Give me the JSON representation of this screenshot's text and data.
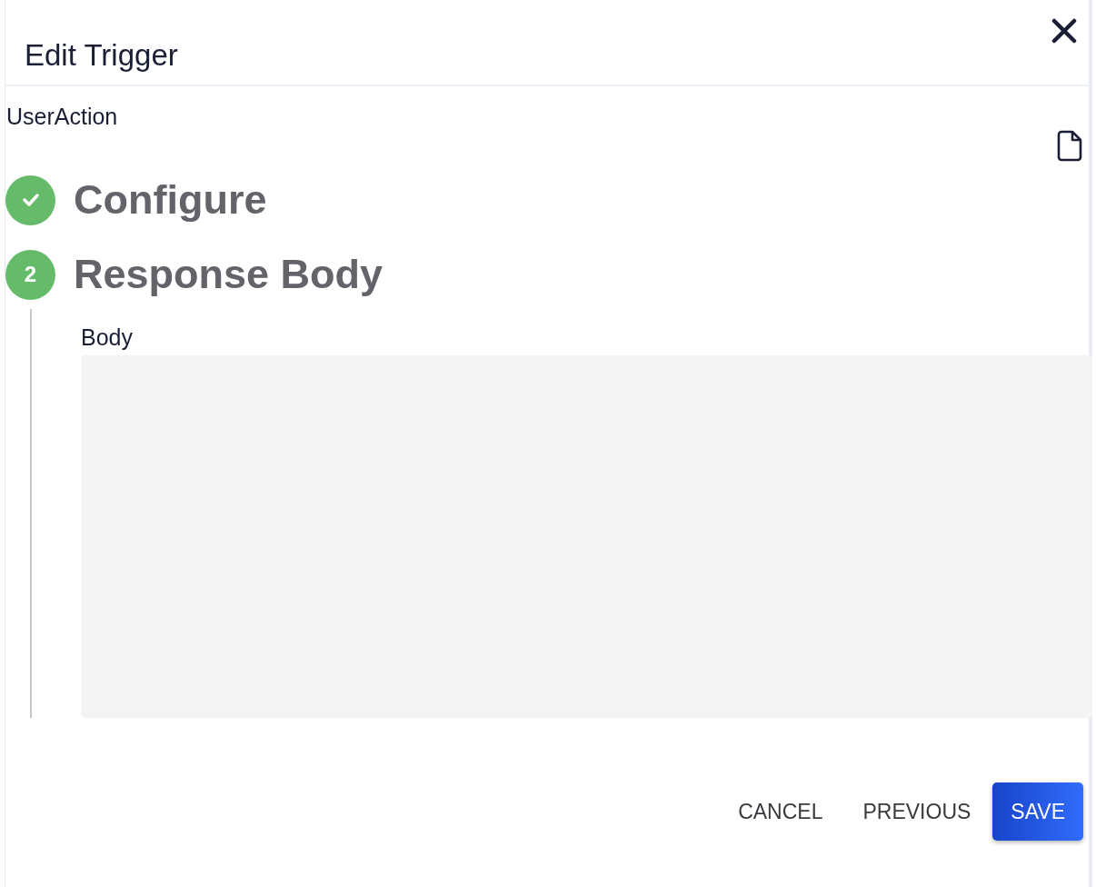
{
  "dialog": {
    "title": "Edit Trigger",
    "subtitle": "UserAction"
  },
  "steps": [
    {
      "title": "Configure",
      "completed": true
    },
    {
      "title": "Response Body",
      "completed": false,
      "number": "2",
      "expanded": true,
      "field": {
        "label": "Body"
      }
    }
  ],
  "buttons": [
    {
      "label": "CANCEL",
      "kind": "text"
    },
    {
      "label": "PREVIOUS",
      "kind": "text"
    },
    {
      "label": "SAVE",
      "kind": "primary"
    }
  ]
}
